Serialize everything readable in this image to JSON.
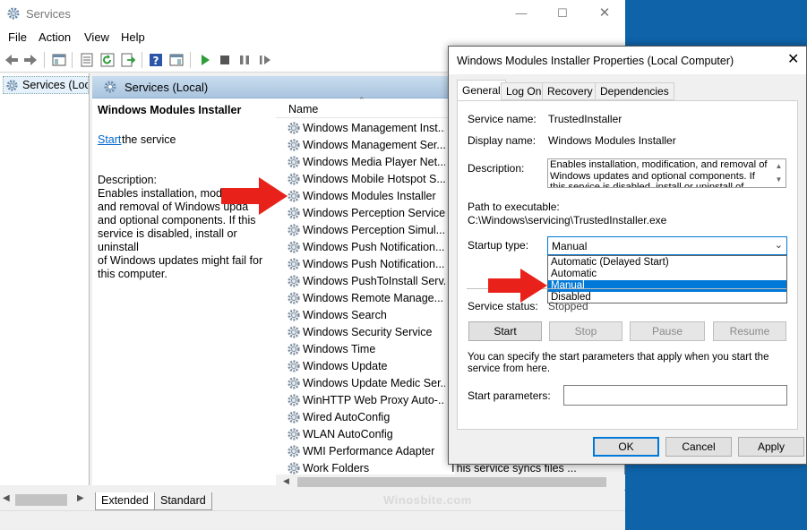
{
  "app": {
    "title": "Services",
    "menu": [
      "File",
      "Action",
      "View",
      "Help"
    ],
    "tree_item": "Services (Local)",
    "details_header": "Services (Local)",
    "column_name": "Name",
    "bottom_tabs": [
      "Extended",
      "Standard"
    ],
    "watermark": "Winosbite.com"
  },
  "details": {
    "title": "Windows Modules Installer",
    "start_link": "Start",
    "start_rest": "the service",
    "description_label": "Description:",
    "description_text": "Enables installation, modifi\nand removal of Windows upda\nand optional components. If this\nservice is disabled, install or uninstall\nof Windows updates might fail for\nthis computer."
  },
  "services": [
    "Windows Management Inst...",
    "Windows Management Ser...",
    "Windows Media Player Net...",
    "Windows Mobile Hotspot S...",
    "Windows Modules Installer",
    "Windows Perception Service",
    "Windows Perception Simul...",
    "Windows Push Notification...",
    "Windows Push Notification...",
    "Windows PushToInstall Serv...",
    "Windows Remote Manage...",
    "Windows Search",
    "Windows Security Service",
    "Windows Time",
    "Windows Update",
    "Windows Update Medic Ser...",
    "WinHTTP Web Proxy Auto-...",
    "Wired AutoConfig",
    "WLAN AutoConfig",
    "WMI Performance Adapter",
    "Work Folders"
  ],
  "partial_description": "This service syncs files ...",
  "dialog": {
    "title": "Windows Modules Installer Properties (Local Computer)",
    "tabs": [
      "General",
      "Log On",
      "Recovery",
      "Dependencies"
    ],
    "service_name_label": "Service name:",
    "service_name": "TrustedInstaller",
    "display_name_label": "Display name:",
    "display_name": "Windows Modules Installer",
    "description_label": "Description:",
    "description": "Enables installation, modification, and removal of Windows updates and optional components. If this service is disabled, install or uninstall of Windows",
    "path_label": "Path to executable:",
    "path": "C:\\Windows\\servicing\\TrustedInstaller.exe",
    "startup_label": "Startup type:",
    "startup_value": "Manual",
    "startup_options": [
      "Automatic (Delayed Start)",
      "Automatic",
      "Manual",
      "Disabled"
    ],
    "status_label": "Service status:",
    "status_value": "Stopped",
    "buttons": {
      "start": "Start",
      "stop": "Stop",
      "pause": "Pause",
      "resume": "Resume"
    },
    "hint": "You can specify the start parameters that apply when you start the service from here.",
    "params_label": "Start parameters:",
    "ok": "OK",
    "cancel": "Cancel",
    "apply": "Apply"
  },
  "colors": {
    "accent": "#0078d7",
    "arrow": "#e8221b",
    "desktop": "#0f63a8"
  }
}
